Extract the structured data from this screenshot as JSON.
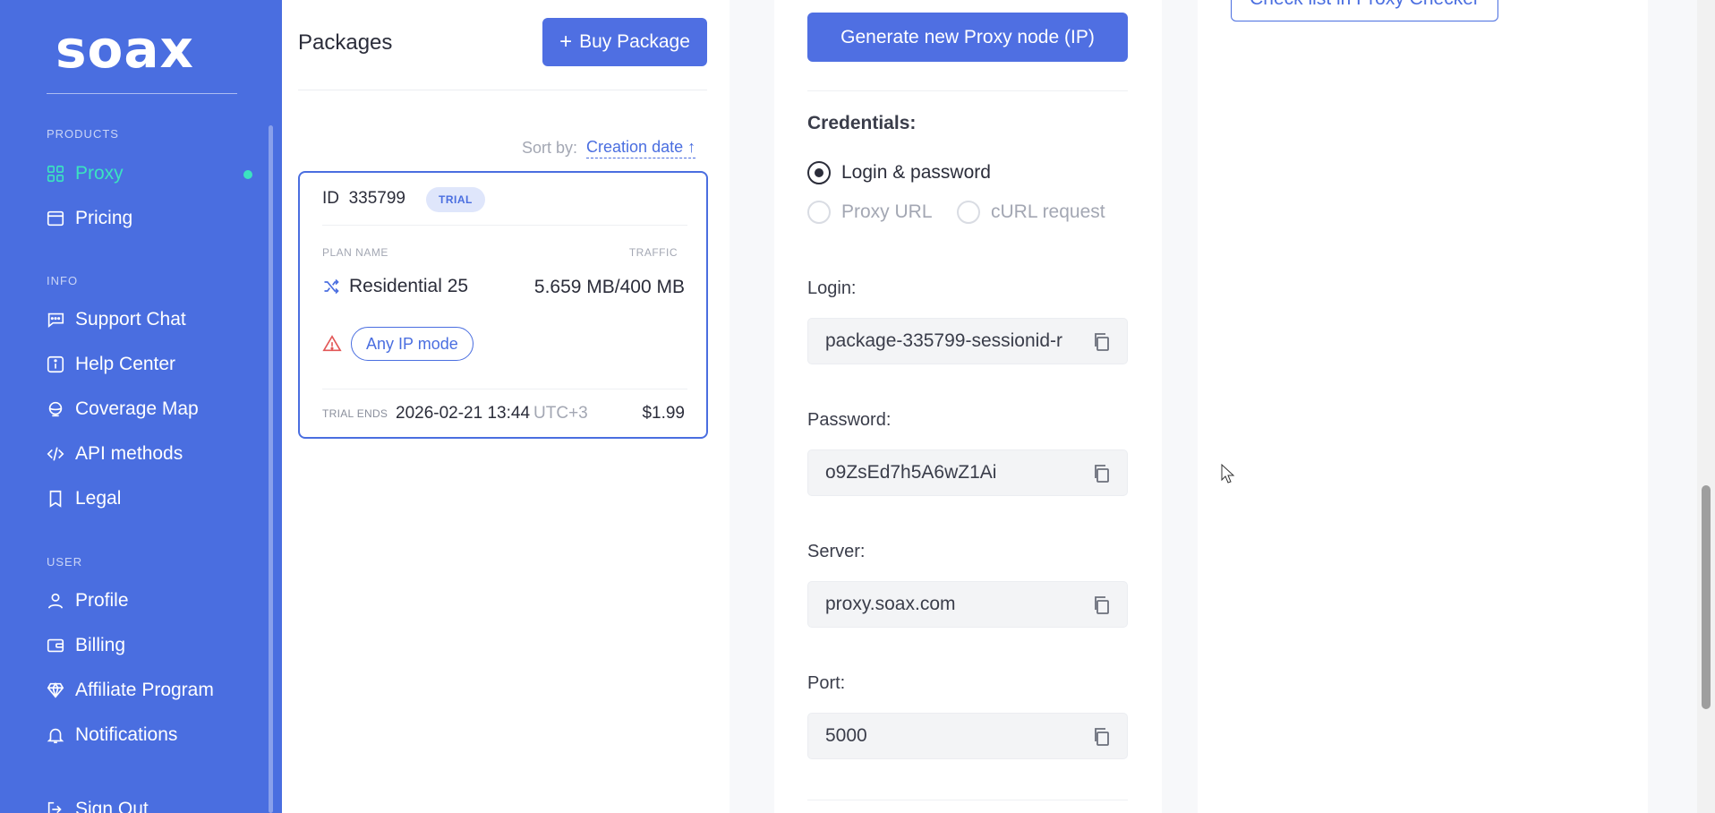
{
  "sidebar": {
    "logo": "soax",
    "sections": {
      "products": "PRODUCTS",
      "info": "INFO",
      "user": "USER"
    },
    "items": [
      {
        "label": "Proxy",
        "icon": "grid-icon",
        "active": true
      },
      {
        "label": "Pricing",
        "icon": "wallet-icon"
      },
      {
        "label": "Support Chat",
        "icon": "chat-icon"
      },
      {
        "label": "Help Center",
        "icon": "info-icon"
      },
      {
        "label": "Coverage Map",
        "icon": "globe-icon"
      },
      {
        "label": "API methods",
        "icon": "code-icon"
      },
      {
        "label": "Legal",
        "icon": "bookmark-icon"
      },
      {
        "label": "Profile",
        "icon": "user-icon"
      },
      {
        "label": "Billing",
        "icon": "card-icon"
      },
      {
        "label": "Affiliate Program",
        "icon": "diamond-icon"
      },
      {
        "label": "Notifications",
        "icon": "bell-icon"
      },
      {
        "label": "Sign Out",
        "icon": "signout-icon"
      }
    ],
    "active_color": "#3be3c0",
    "background": "#4a6ee0"
  },
  "packages": {
    "title": "Packages",
    "buy_label": "Buy Package",
    "sort_label": "Sort by:",
    "sort_value": "Creation date ↑",
    "card": {
      "id_label": "ID",
      "id": "335799",
      "badge": "TRIAL",
      "plan_header": "PLAN NAME",
      "traffic_header": "TRAFFIC",
      "plan_name": "Residential 25",
      "traffic": "5.659 MB/400 MB",
      "ip_mode": "Any IP mode",
      "trial_ends_label": "TRIAL ENDS",
      "trial_ends": "2026-02-21 13:44",
      "timezone": "UTC+3",
      "price": "$1.99"
    }
  },
  "credentials": {
    "generate_label": "Generate new Proxy node (IP)",
    "title": "Credentials:",
    "options": [
      "Login & password",
      "Proxy URL",
      "cURL request"
    ],
    "selected": "Login & password",
    "login_label": "Login:",
    "login": "package-335799-sessionid-r",
    "password_label": "Password:",
    "password": "o9ZsEd7h5A6wZ1Ai",
    "server_label": "Server:",
    "server": "proxy.soax.com",
    "port_label": "Port:",
    "port": "5000"
  },
  "checker": {
    "label": "Check list in Proxy Checker"
  }
}
